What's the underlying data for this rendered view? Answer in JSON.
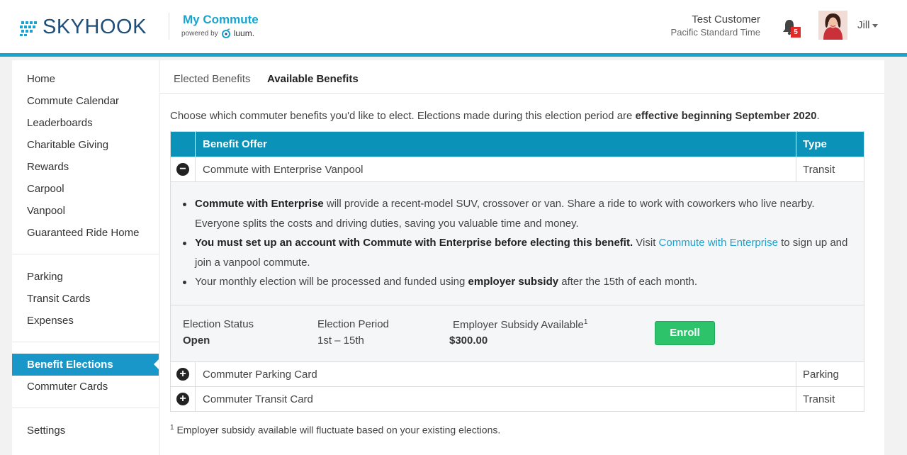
{
  "header": {
    "brand": "SKYHOOK",
    "app_title": "My Commute",
    "powered_by": "powered by",
    "powered_brand": "luum.",
    "user_full_name": "Test Customer",
    "timezone": "Pacific Standard Time",
    "notifications_count": "5",
    "user_short_name": "Jill"
  },
  "sidebar": {
    "group1": [
      "Home",
      "Commute Calendar",
      "Leaderboards",
      "Charitable Giving",
      "Rewards",
      "Carpool",
      "Vanpool",
      "Guaranteed Ride Home"
    ],
    "group2": [
      "Parking",
      "Transit Cards",
      "Expenses"
    ],
    "active": "Benefit Elections",
    "group3": [
      "Commuter Cards"
    ],
    "settings": "Settings"
  },
  "tabs": [
    "Elected Benefits",
    "Available Benefits"
  ],
  "intro": {
    "text": "Choose which commuter benefits you'd like to elect. Elections made during this election period are ",
    "bold": "effective beginning September 2020",
    "end": "."
  },
  "table": {
    "headers": {
      "offer": "Benefit Offer",
      "type": "Type"
    },
    "rows": [
      {
        "label": "Commute with Enterprise Vanpool",
        "type": "Transit",
        "icon": "minus"
      },
      {
        "label": "Commuter Parking Card",
        "type": "Parking",
        "icon": "plus"
      },
      {
        "label": "Commuter Transit Card",
        "type": "Transit",
        "icon": "plus"
      }
    ]
  },
  "details": {
    "b1_bold": "Commute with Enterprise",
    "b1_text": " will provide a recent-model SUV, crossover or van. Share a ride to work with coworkers who live nearby. Everyone splits the costs and driving duties, saving you valuable time and money.",
    "b2_bold": "You must set up an account with Commute with Enterprise before electing this benefit.",
    "b2_pre": " Visit ",
    "b2_link": "Commute with Enterprise",
    "b2_post": " to sign up and join a vanpool commute.",
    "b3_pre": "Your monthly election will be processed and funded using ",
    "b3_bold": "employer subsidy",
    "b3_post": " after the 15th of each month."
  },
  "election": {
    "status_label": "Election Status",
    "status_value": "Open",
    "period_label": "Election Period",
    "period_value": "1st – 15th",
    "subsidy_label": "Employer Subsidy Available",
    "subsidy_sup": "1",
    "subsidy_value": "$300.00",
    "enroll_label": "Enroll"
  },
  "footnote": {
    "sup": "1",
    "text": " Employer subsidy available will fluctuate based on your existing elections."
  },
  "colors": {
    "accent": "#1aa3cf",
    "table_header": "#0a92b8",
    "enroll": "#2cc36b",
    "badge": "#e02b2b"
  }
}
